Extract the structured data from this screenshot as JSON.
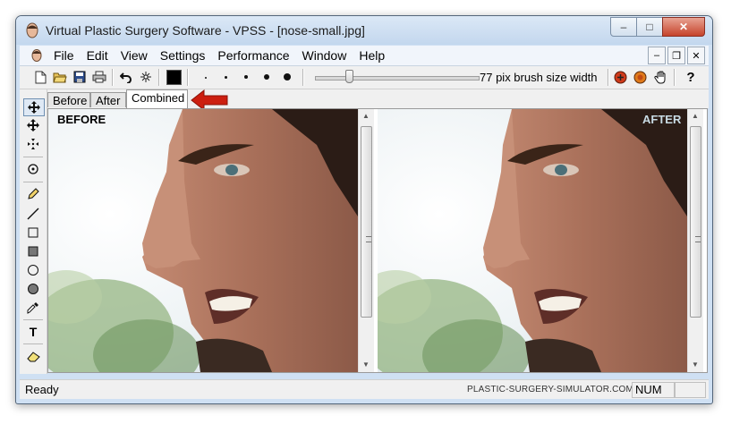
{
  "window": {
    "title": "Virtual Plastic Surgery Software - VPSS - [nose-small.jpg]",
    "controls": {
      "minimize": "–",
      "maximize": "□",
      "close": "✕"
    }
  },
  "menu": {
    "items": [
      "File",
      "Edit",
      "View",
      "Settings",
      "Performance",
      "Window",
      "Help"
    ],
    "mdi_controls": {
      "minimize": "–",
      "restore": "❐",
      "close": "✕"
    }
  },
  "toolbar": {
    "brush_label": "77 pix brush size width",
    "active_color": "#000000",
    "brush_size_slider": 0.2
  },
  "tabs": {
    "items": [
      "Before",
      "After",
      "Combined"
    ],
    "selected": "Combined"
  },
  "panes": {
    "before_label": "BEFORE",
    "after_label": "AFTER"
  },
  "tools": {
    "text_tool": "T"
  },
  "status": {
    "text": "Ready",
    "website": "PLASTIC-SURGERY-SIMULATOR.COM",
    "num": "NUM"
  },
  "colors": {
    "accent_red": "#cc1f10",
    "window_frame": "#cfe0f3",
    "close_button": "#c6432b"
  }
}
